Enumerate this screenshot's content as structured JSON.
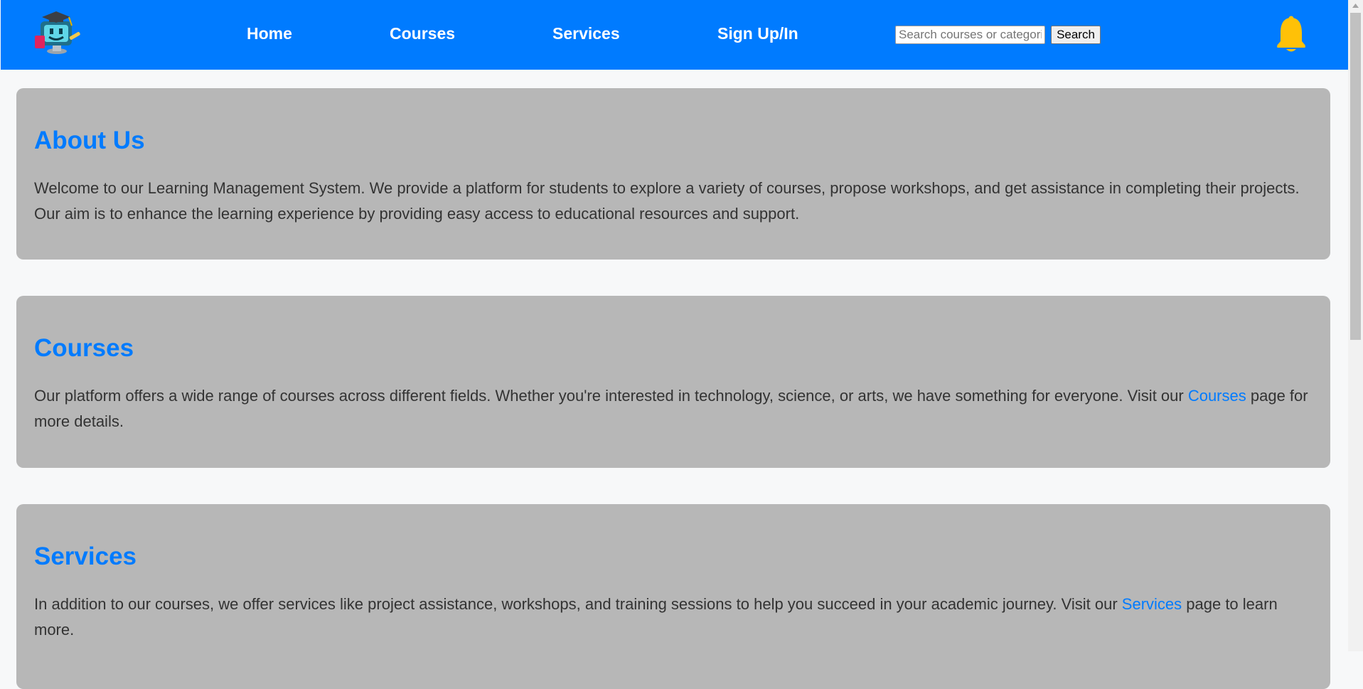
{
  "nav": {
    "links": [
      "Home",
      "Courses",
      "Services",
      "Sign Up/In"
    ],
    "search_placeholder": "Search courses or categories",
    "search_button": "Search"
  },
  "about": {
    "title": "About Us",
    "text": "Welcome to our Learning Management System. We provide a platform for students to explore a variety of courses, propose workshops, and get assistance in completing their projects. Our aim is to enhance the learning experience by providing easy access to educational resources and support."
  },
  "courses": {
    "title": "Courses",
    "text_before": "Our platform offers a wide range of courses across different fields. Whether you're interested in technology, science, or arts, we have something for everyone. Visit our ",
    "link": "Courses",
    "text_after": " page for more details."
  },
  "services": {
    "title": "Services",
    "text_before": "In addition to our courses, we offer services like project assistance, workshops, and training sessions to help you succeed in your academic journey. Visit our ",
    "link": "Services",
    "text_after": " page to learn more."
  },
  "colors": {
    "brand": "#007bff",
    "card": "#b7b7b7",
    "page": "#f7f8f9",
    "bell": "#ffc107"
  }
}
